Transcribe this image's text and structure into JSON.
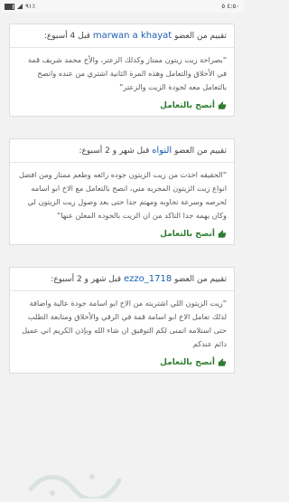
{
  "status_bar": {
    "left": "٤:٥٠ ٥",
    "right": "٩١٪"
  },
  "reviews": [
    {
      "prefix": "تقييم من العضو",
      "user": "marwan a khayat",
      "time": "قبل 4 أسبوع:",
      "body": "بصراحة زيت زيتون ممتاز وكذلك الزعتر، والأخ محمد شريف قمة في الأخلاق والتعامل وهذه المرة الثانية اشتري من عنده وانصح بالتعامل معه لجودة الزيت والزعتر",
      "recommend": "أنصح بالتعامل"
    },
    {
      "prefix": "تقييم من العضو",
      "user": "النواه",
      "time": "قبل شهر و 2 أسبوع:",
      "body": "الحقيقه اخذت من زيت الزيتون جوده رائعه وطعم ممتاز ومن افضل انواع زيت الزيتون المجربه مني، انصح بالتعامل مع الاخ ابو اسامه لحرصه وسرعة تجاوبه ومهتم جدا حتى بعد وصول زيت الزيتون لي وكان يهمه جدا التاكد من ان الزيت بالجوده المعلن عنها",
      "recommend": "أنصح بالتعامل"
    },
    {
      "prefix": "تقييم من العضو",
      "user": "ezzo_1718",
      "time": "قبل شهر و 2 أسبوع:",
      "body": "زيت الزيتون اللي اشتريته من الاخ ابو اسامة جودة عالية واضافة لذلك تعامل الاخ ابو اسامة قمة في الرقي والأخلاق ومتابعة الطلب حتى استلامه اتمنى لكم التوفيق ان شاء الله وبإذن الكريم اني عميل دائم عندكم",
      "recommend": "أنصح بالتعامل"
    }
  ],
  "colors": {
    "username": "#1b5fb0",
    "recommend": "#2e7d32"
  }
}
